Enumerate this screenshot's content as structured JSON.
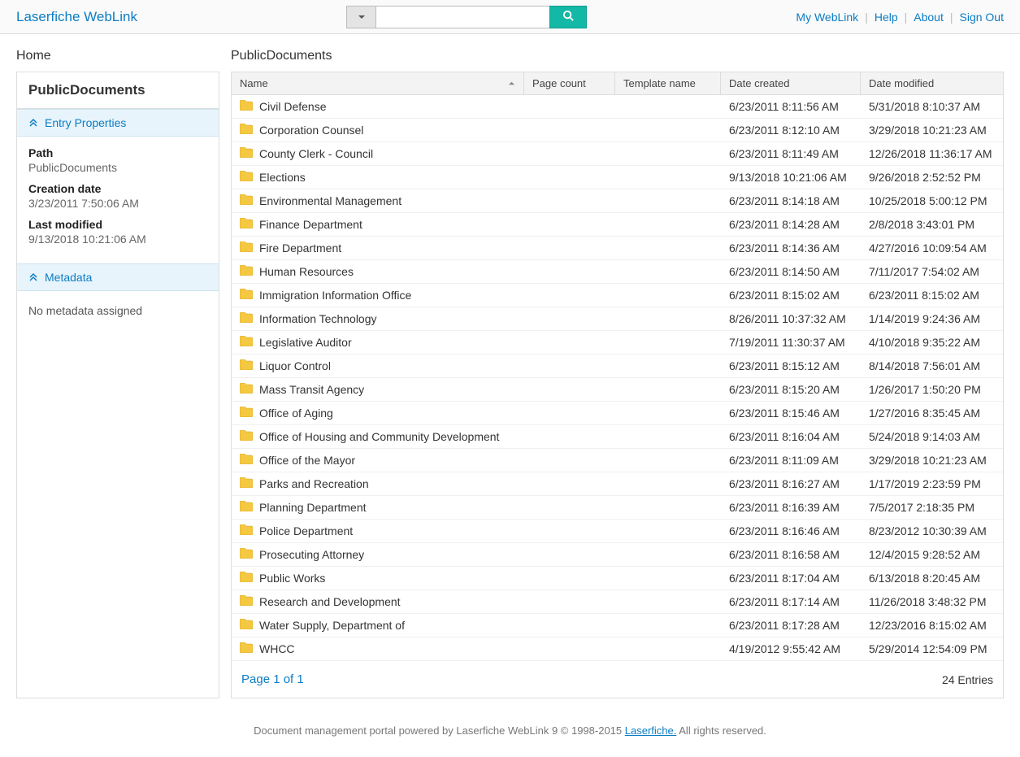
{
  "header": {
    "logo": "Laserfiche WebLink",
    "links": {
      "my_weblink": "My WebLink",
      "help": "Help",
      "about": "About",
      "signout": "Sign Out"
    }
  },
  "breadcrumb": {
    "home": "Home",
    "current": "PublicDocuments"
  },
  "sidebar": {
    "title": "PublicDocuments",
    "section_props": "Entry Properties",
    "section_meta": "Metadata",
    "meta_empty": "No metadata assigned",
    "props": {
      "path_label": "Path",
      "path_value": "PublicDocuments",
      "created_label": "Creation date",
      "created_value": "3/23/2011 7:50:06 AM",
      "modified_label": "Last modified",
      "modified_value": "9/13/2018 10:21:06 AM"
    }
  },
  "table": {
    "headers": {
      "name": "Name",
      "pages": "Page count",
      "template": "Template name",
      "created": "Date created",
      "modified": "Date modified"
    },
    "rows": [
      {
        "name": "Civil Defense",
        "created": "6/23/2011 8:11:56 AM",
        "modified": "5/31/2018 8:10:37 AM"
      },
      {
        "name": "Corporation Counsel",
        "created": "6/23/2011 8:12:10 AM",
        "modified": "3/29/2018 10:21:23 AM"
      },
      {
        "name": "County Clerk - Council",
        "created": "6/23/2011 8:11:49 AM",
        "modified": "12/26/2018 11:36:17 AM"
      },
      {
        "name": "Elections",
        "created": "9/13/2018 10:21:06 AM",
        "modified": "9/26/2018 2:52:52 PM"
      },
      {
        "name": "Environmental Management",
        "created": "6/23/2011 8:14:18 AM",
        "modified": "10/25/2018 5:00:12 PM"
      },
      {
        "name": "Finance Department",
        "created": "6/23/2011 8:14:28 AM",
        "modified": "2/8/2018 3:43:01 PM"
      },
      {
        "name": "Fire Department",
        "created": "6/23/2011 8:14:36 AM",
        "modified": "4/27/2016 10:09:54 AM"
      },
      {
        "name": "Human Resources",
        "created": "6/23/2011 8:14:50 AM",
        "modified": "7/11/2017 7:54:02 AM"
      },
      {
        "name": "Immigration Information Office",
        "created": "6/23/2011 8:15:02 AM",
        "modified": "6/23/2011 8:15:02 AM"
      },
      {
        "name": "Information Technology",
        "created": "8/26/2011 10:37:32 AM",
        "modified": "1/14/2019 9:24:36 AM"
      },
      {
        "name": "Legislative Auditor",
        "created": "7/19/2011 11:30:37 AM",
        "modified": "4/10/2018 9:35:22 AM"
      },
      {
        "name": "Liquor Control",
        "created": "6/23/2011 8:15:12 AM",
        "modified": "8/14/2018 7:56:01 AM"
      },
      {
        "name": "Mass Transit Agency",
        "created": "6/23/2011 8:15:20 AM",
        "modified": "1/26/2017 1:50:20 PM"
      },
      {
        "name": "Office of Aging",
        "created": "6/23/2011 8:15:46 AM",
        "modified": "1/27/2016 8:35:45 AM"
      },
      {
        "name": "Office of Housing and Community Development",
        "created": "6/23/2011 8:16:04 AM",
        "modified": "5/24/2018 9:14:03 AM"
      },
      {
        "name": "Office of the Mayor",
        "created": "6/23/2011 8:11:09 AM",
        "modified": "3/29/2018 10:21:23 AM"
      },
      {
        "name": "Parks and Recreation",
        "created": "6/23/2011 8:16:27 AM",
        "modified": "1/17/2019 2:23:59 PM"
      },
      {
        "name": "Planning Department",
        "created": "6/23/2011 8:16:39 AM",
        "modified": "7/5/2017 2:18:35 PM"
      },
      {
        "name": "Police Department",
        "created": "6/23/2011 8:16:46 AM",
        "modified": "8/23/2012 10:30:39 AM"
      },
      {
        "name": "Prosecuting Attorney",
        "created": "6/23/2011 8:16:58 AM",
        "modified": "12/4/2015 9:28:52 AM"
      },
      {
        "name": "Public Works",
        "created": "6/23/2011 8:17:04 AM",
        "modified": "6/13/2018 8:20:45 AM"
      },
      {
        "name": "Research and Development",
        "created": "6/23/2011 8:17:14 AM",
        "modified": "11/26/2018 3:48:32 PM"
      },
      {
        "name": "Water Supply, Department of",
        "created": "6/23/2011 8:17:28 AM",
        "modified": "12/23/2016 8:15:02 AM"
      },
      {
        "name": "WHCC",
        "created": "4/19/2012 9:55:42 AM",
        "modified": "5/29/2014 12:54:09 PM"
      }
    ],
    "page_info": "Page 1 of 1",
    "entry_count": "24 Entries"
  },
  "footer": {
    "text_before": "Document management portal powered by Laserfiche WebLink 9 © 1998-2015 ",
    "link": "Laserfiche.",
    "text_after": " All rights reserved."
  }
}
